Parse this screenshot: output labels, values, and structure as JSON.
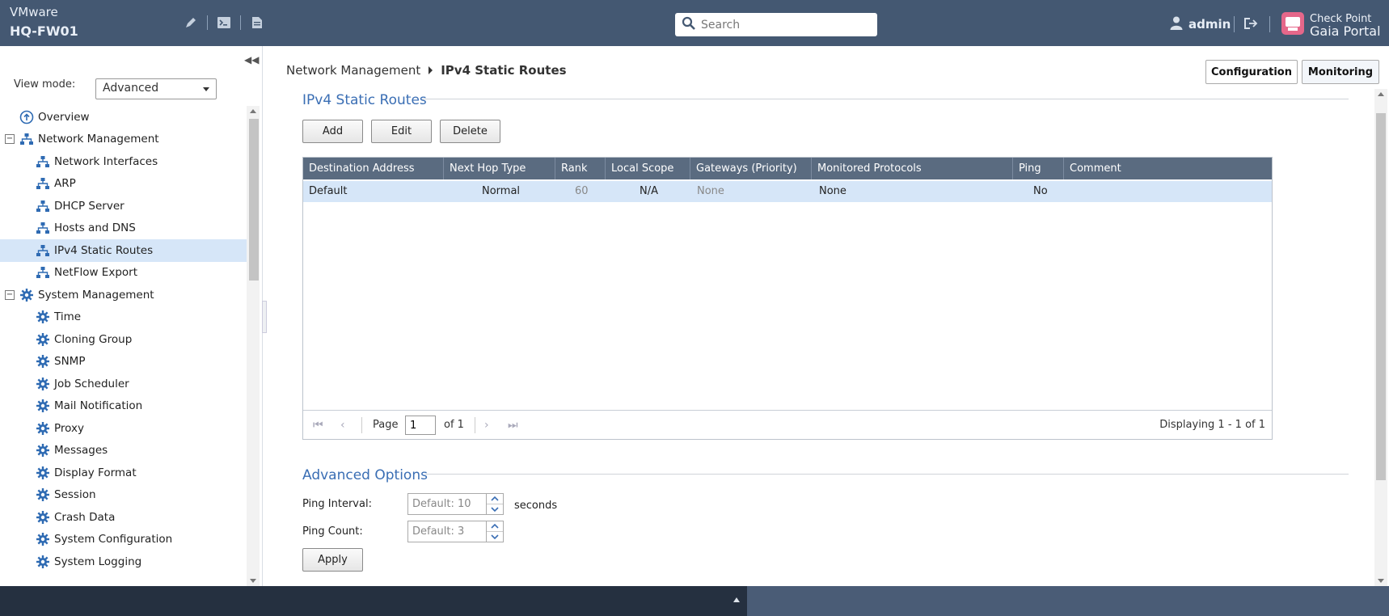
{
  "header": {
    "vendor": "VMware",
    "hostname": "HQ-FW01",
    "search_placeholder": "Search",
    "user": "admin",
    "logo_line1": "Check Point",
    "logo_line2": "Gaia Portal"
  },
  "sidebar": {
    "view_mode_label": "View mode:",
    "view_mode_value": "Advanced",
    "items": [
      {
        "label": "Overview",
        "level": 0,
        "icon": "overview-icon"
      },
      {
        "label": "Network Management",
        "level": 0,
        "icon": "network-icon",
        "expanded": true
      },
      {
        "label": "Network Interfaces",
        "level": 1,
        "icon": "network-icon"
      },
      {
        "label": "ARP",
        "level": 1,
        "icon": "network-icon"
      },
      {
        "label": "DHCP Server",
        "level": 1,
        "icon": "network-icon"
      },
      {
        "label": "Hosts and DNS",
        "level": 1,
        "icon": "network-icon"
      },
      {
        "label": "IPv4 Static Routes",
        "level": 1,
        "icon": "network-icon",
        "selected": true
      },
      {
        "label": "NetFlow Export",
        "level": 1,
        "icon": "network-icon"
      },
      {
        "label": "System Management",
        "level": 0,
        "icon": "gear-icon",
        "expanded": true
      },
      {
        "label": "Time",
        "level": 1,
        "icon": "gear-icon"
      },
      {
        "label": "Cloning Group",
        "level": 1,
        "icon": "gear-icon"
      },
      {
        "label": "SNMP",
        "level": 1,
        "icon": "gear-icon"
      },
      {
        "label": "Job Scheduler",
        "level": 1,
        "icon": "gear-icon"
      },
      {
        "label": "Mail Notification",
        "level": 1,
        "icon": "gear-icon"
      },
      {
        "label": "Proxy",
        "level": 1,
        "icon": "gear-icon"
      },
      {
        "label": "Messages",
        "level": 1,
        "icon": "gear-icon"
      },
      {
        "label": "Display Format",
        "level": 1,
        "icon": "gear-icon"
      },
      {
        "label": "Session",
        "level": 1,
        "icon": "gear-icon"
      },
      {
        "label": "Crash Data",
        "level": 1,
        "icon": "gear-icon"
      },
      {
        "label": "System Configuration",
        "level": 1,
        "icon": "gear-icon"
      },
      {
        "label": "System Logging",
        "level": 1,
        "icon": "gear-icon"
      }
    ]
  },
  "breadcrumb": {
    "parent": "Network Management",
    "current": "IPv4 Static Routes"
  },
  "top_buttons": {
    "configuration": "Configuration",
    "monitoring": "Monitoring"
  },
  "routes_section": {
    "title": "IPv4 Static Routes",
    "add": "Add",
    "edit": "Edit",
    "delete": "Delete",
    "columns": [
      "Destination Address",
      "Next Hop Type",
      "Rank",
      "Local Scope",
      "Gateways (Priority)",
      "Monitored Protocols",
      "Ping",
      "Comment"
    ],
    "rows": [
      [
        "Default",
        "Normal",
        "60",
        "N/A",
        "None",
        "None",
        "No",
        ""
      ]
    ],
    "pager": {
      "page_label": "Page",
      "page_value": "1",
      "of_label": "of 1",
      "display": "Displaying 1 - 1 of 1"
    }
  },
  "advanced_section": {
    "title": "Advanced Options",
    "ping_interval_label": "Ping Interval:",
    "ping_interval_placeholder": "Default: 10",
    "seconds": "seconds",
    "ping_count_label": "Ping Count:",
    "ping_count_placeholder": "Default: 3",
    "apply": "Apply"
  }
}
